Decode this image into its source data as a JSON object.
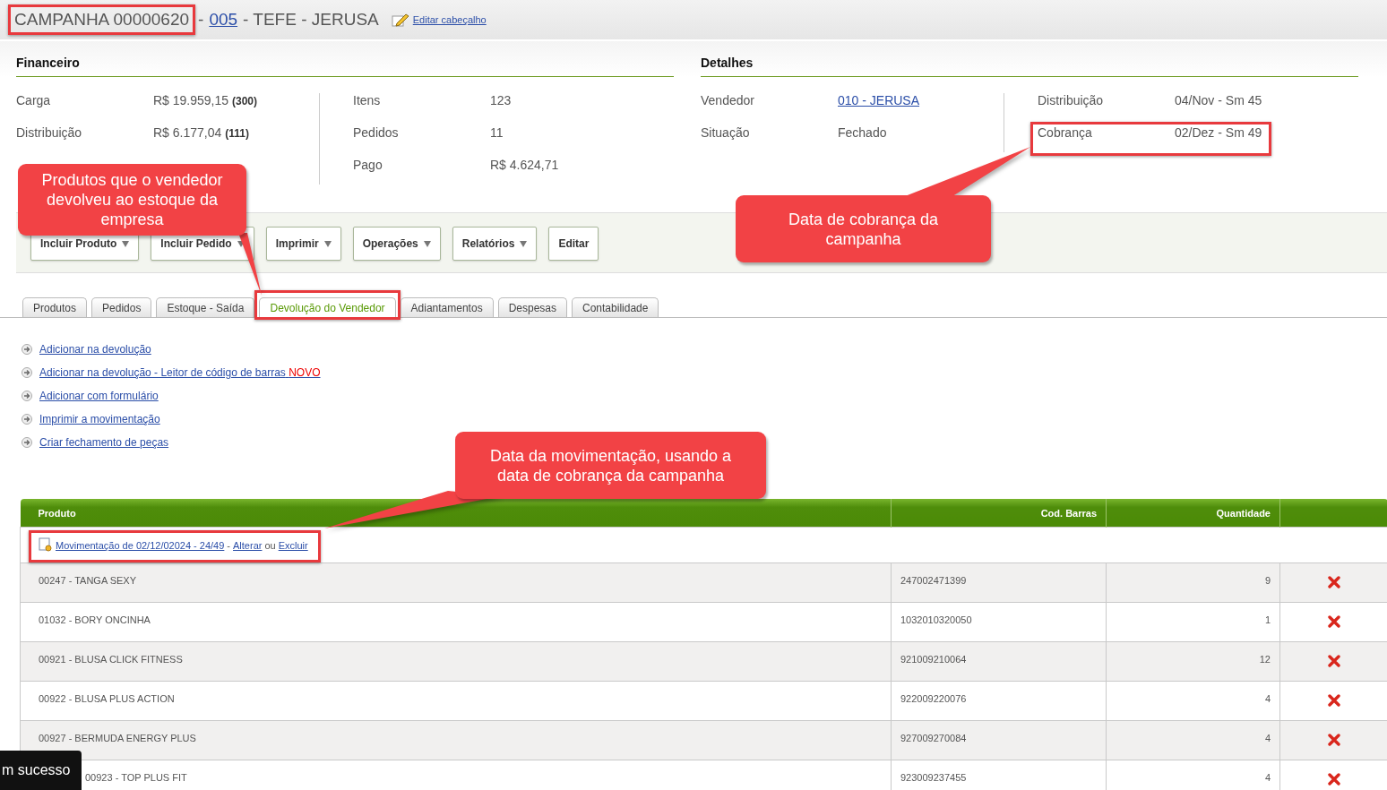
{
  "header": {
    "code": "CAMPANHA 00000620",
    "code_highlighted": true,
    "separator": "-",
    "link": "005",
    "rest": "- TEFE - JERUSA",
    "edit_link": "Editar cabeçalho"
  },
  "financeiro": {
    "title": "Financeiro",
    "columns": [
      [
        {
          "label": "Carga",
          "value": "R$ 19.959,15",
          "count": "(300)"
        },
        {
          "label": "Distribuição",
          "value": "R$ 6.177,04",
          "count": "(111)"
        }
      ],
      [
        {
          "label": "Itens",
          "value": "123"
        },
        {
          "label": "Pedidos",
          "value": "11"
        },
        {
          "label": "Pago",
          "value": "R$ 4.624,71"
        }
      ]
    ]
  },
  "detalhes": {
    "title": "Detalhes",
    "columns": [
      [
        {
          "label": "Vendedor",
          "value": "010 - JERUSA",
          "kind": "link",
          "highlighted": false
        },
        {
          "label": "Situação",
          "value": "Fechado",
          "kind": "text",
          "highlighted": false
        }
      ],
      [
        {
          "label": "Distribuição",
          "value": "04/Nov - Sm 45",
          "kind": "text",
          "highlighted": false
        },
        {
          "label": "Cobrança",
          "value": "02/Dez - Sm 49",
          "kind": "text",
          "highlighted": true
        }
      ]
    ]
  },
  "toolbar": [
    {
      "label": "Incluir Produto",
      "dropdown": true
    },
    {
      "label": "Incluir Pedido",
      "dropdown": true
    },
    {
      "label": "Imprimir",
      "dropdown": true
    },
    {
      "label": "Operações",
      "dropdown": true
    },
    {
      "label": "Relatórios",
      "dropdown": true
    },
    {
      "label": "Editar",
      "dropdown": false
    }
  ],
  "tabs": [
    {
      "label": "Produtos",
      "selected": false,
      "highlighted": false
    },
    {
      "label": "Pedidos",
      "selected": false,
      "highlighted": false
    },
    {
      "label": "Estoque - Saída",
      "selected": false,
      "highlighted": false
    },
    {
      "label": "Devolução do Vendedor",
      "selected": true,
      "highlighted": true
    },
    {
      "label": "Adiantamentos",
      "selected": false,
      "highlighted": false
    },
    {
      "label": "Despesas",
      "selected": false,
      "highlighted": false
    },
    {
      "label": "Contabilidade",
      "selected": false,
      "highlighted": false
    }
  ],
  "actions": [
    {
      "text": "Adicionar na devolução"
    },
    {
      "text": "Adicionar na devolução - Leitor de código de barras",
      "badge": "NOVO"
    },
    {
      "text": "Adicionar com formulário"
    },
    {
      "text": "Imprimir a movimentação"
    },
    {
      "text": "Criar fechamento de peças"
    }
  ],
  "table": {
    "columns": [
      "Produto",
      "Cod. Barras",
      "Quantidade"
    ],
    "movement": {
      "link": "Movimentação de 02/12/02024 - 24/49",
      "separator": "-",
      "edit": "Alterar",
      "conjunction": "ou",
      "delete": "Excluir",
      "highlighted": true
    },
    "rows": [
      {
        "product": "00247 - TANGA SEXY",
        "barcode": "247002471399",
        "quantity": "9"
      },
      {
        "product": "01032 - BORY ONCINHA",
        "barcode": "1032010320050",
        "quantity": "1"
      },
      {
        "product": "00921 - BLUSA CLICK FITNESS",
        "barcode": "921009210064",
        "quantity": "12"
      },
      {
        "product": "00922 - BLUSA PLUS ACTION",
        "barcode": "922009220076",
        "quantity": "4"
      },
      {
        "product": "00927 - BERMUDA ENERGY PLUS",
        "barcode": "927009270084",
        "quantity": "4"
      },
      {
        "product": "00923 - TOP PLUS FIT",
        "barcode": "923009237455",
        "quantity": "4"
      }
    ]
  },
  "callouts": [
    {
      "text": "Produtos que o vendedor devolveu ao estoque da empresa"
    },
    {
      "text": "Data de cobrança da campanha"
    },
    {
      "text": "Data da movimentação, usando a data de cobrança da campanha"
    }
  ],
  "toast": {
    "text": "m sucesso"
  }
}
